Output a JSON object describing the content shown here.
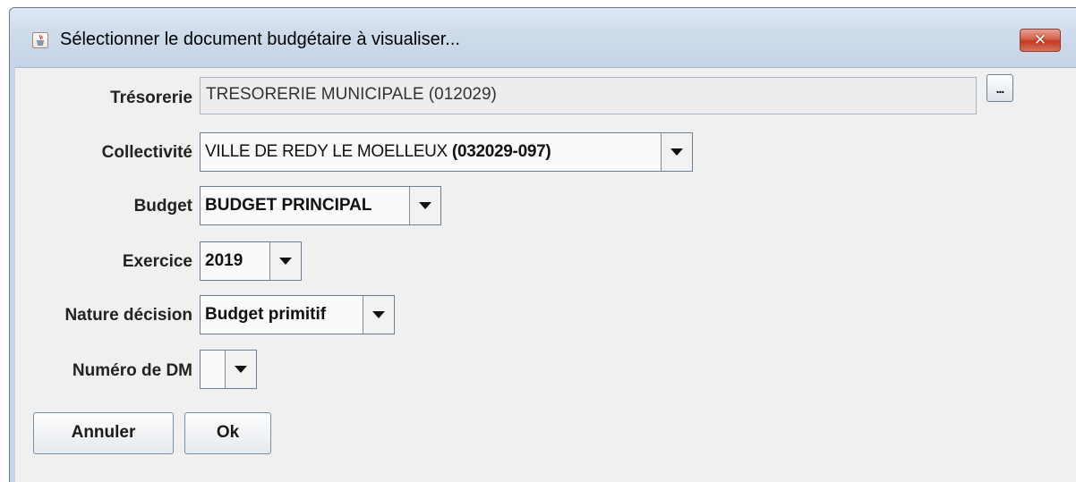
{
  "window": {
    "title": "Sélectionner le document budgétaire à visualiser...",
    "close_label": "✕",
    "app_icon": "java-icon"
  },
  "form": {
    "tresorerie": {
      "label": "Trésorerie",
      "value": "TRESORERIE MUNICIPALE (012029)",
      "browse_label": "..."
    },
    "collectivite": {
      "label": "Collectivité",
      "value_name": "VILLE DE REDY LE MOELLEUX",
      "value_code": "(032029-097)"
    },
    "budget": {
      "label": "Budget",
      "value": "BUDGET PRINCIPAL"
    },
    "exercice": {
      "label": "Exercice",
      "value": "2019"
    },
    "nature_decision": {
      "label": "Nature décision",
      "value": "Budget primitif"
    },
    "numero_dm": {
      "label": "Numéro de DM",
      "value": ""
    }
  },
  "buttons": {
    "cancel": "Annuler",
    "ok": "Ok"
  }
}
